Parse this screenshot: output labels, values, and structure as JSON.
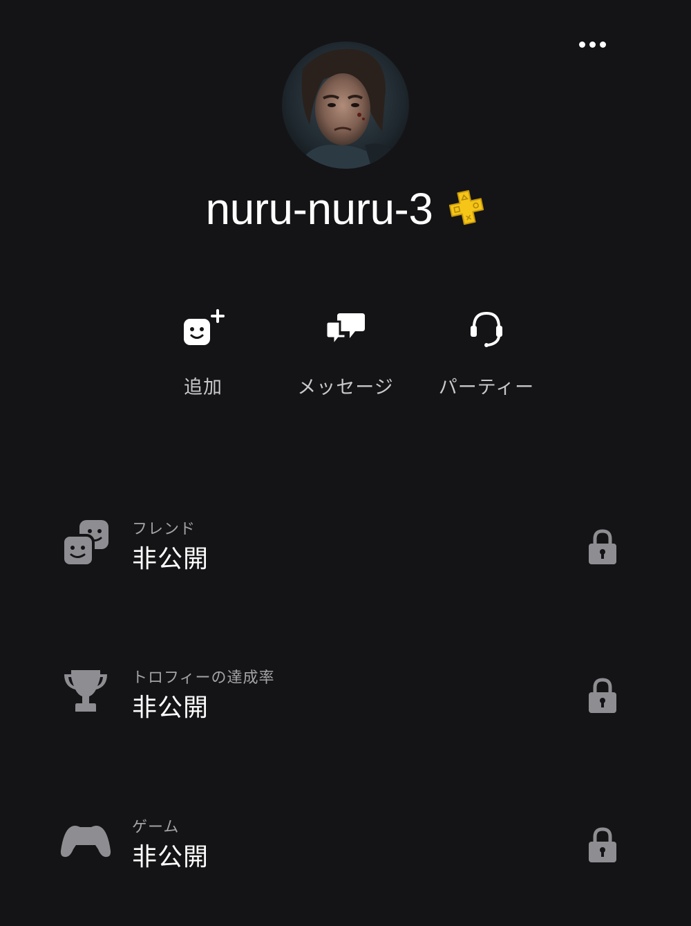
{
  "header": {
    "more_menu_icon": "ellipsis-icon"
  },
  "profile": {
    "avatar_icon": "avatar-image",
    "username": "nuru-nuru-3",
    "membership_badge_icon": "ps-plus-icon",
    "badge_color": "#f5c518"
  },
  "actions": [
    {
      "id": "add",
      "icon": "add-friend-icon",
      "label": "追加"
    },
    {
      "id": "message",
      "icon": "message-icon",
      "label": "メッセージ"
    },
    {
      "id": "party",
      "icon": "headset-icon",
      "label": "パーティー"
    }
  ],
  "rows": [
    {
      "id": "friends",
      "icon": "friends-icon",
      "caption": "フレンド",
      "value": "非公開",
      "status_icon": "lock-icon"
    },
    {
      "id": "trophies",
      "icon": "trophy-icon",
      "caption": "トロフィーの達成率",
      "value": "非公開",
      "status_icon": "lock-icon"
    },
    {
      "id": "games",
      "icon": "controller-icon",
      "caption": "ゲーム",
      "value": "非公開",
      "status_icon": "lock-icon"
    }
  ],
  "colors": {
    "background": "#141416",
    "text_primary": "#ffffff",
    "text_secondary": "#a4a4a8",
    "icon_muted": "#8e8e92"
  }
}
